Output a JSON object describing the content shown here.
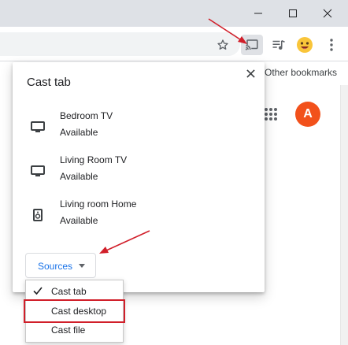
{
  "window": {
    "controls": {
      "minimize": "minimize-icon",
      "maximize": "maximize-icon",
      "close": "close-icon"
    }
  },
  "toolbar": {
    "icons": [
      "star-icon",
      "cast-icon",
      "media-control-icon",
      "profile-avatar-icon",
      "menu-icon"
    ]
  },
  "bookmarks": {
    "other_label": "Other bookmarks"
  },
  "page": {
    "account_initial": "A",
    "account_color": "#f2511b"
  },
  "cast_dialog": {
    "title": "Cast tab",
    "devices": [
      {
        "name": "Bedroom TV",
        "status": "Available",
        "icon": "tv-icon"
      },
      {
        "name": "Living Room TV",
        "status": "Available",
        "icon": "tv-icon"
      },
      {
        "name": "Living room Home",
        "status": "Available",
        "icon": "speaker-icon"
      }
    ],
    "sources_label": "Sources"
  },
  "sources_menu": {
    "items": [
      {
        "label": "Cast tab",
        "checked": true
      },
      {
        "label": "Cast desktop",
        "checked": false,
        "highlighted": true
      },
      {
        "label": "Cast file",
        "checked": false
      }
    ]
  },
  "colors": {
    "annotation": "#d11f2a",
    "accent": "#1a73e8"
  }
}
